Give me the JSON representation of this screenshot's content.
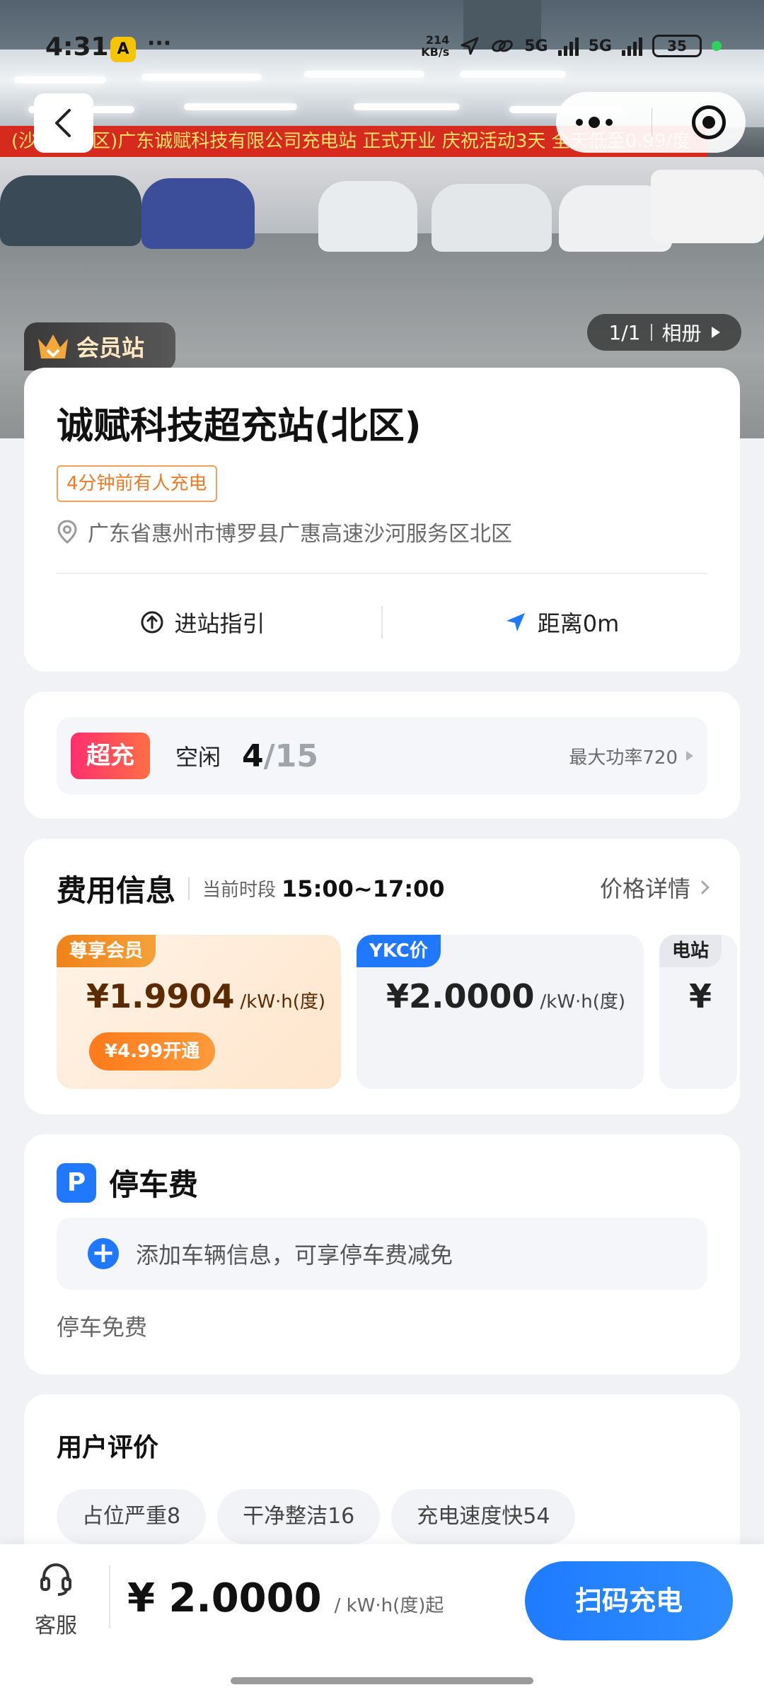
{
  "status_bar": {
    "time": "4:31",
    "more": "···",
    "speed": "214\nKB/s",
    "signal_1": "5G",
    "signal_2": "5G",
    "battery": "35"
  },
  "hero": {
    "banner_text": "(沙河服务区)广东诚赋科技有限公司充电站 正式开业 庆祝活动3天 全天低至0.99/度",
    "member_tag": "会员站",
    "album_index": "1/1",
    "album_label": "相册"
  },
  "station": {
    "name": "诚赋科技超充站(北区)",
    "recent": "4分钟前有人充电",
    "address": "广东省惠州市博罗县广惠高速沙河服务区北区",
    "guide_label": "进站指引",
    "distance_label": "距离0m"
  },
  "availability": {
    "badge": "超充",
    "idle_label": "空闲",
    "idle_count": "4",
    "total": "/15",
    "max_power": "最大功率720"
  },
  "fees": {
    "title": "费用信息",
    "period_label": "当前时段",
    "period": "15:00~17:00",
    "detail_link": "价格详情",
    "cards": [
      {
        "tag": "尊享会员",
        "price": "¥1.9904",
        "unit": "/kW·h(度)",
        "action": "¥4.99开通"
      },
      {
        "tag": "YKC价",
        "price": "¥2.0000",
        "unit": "/kW·h(度)"
      },
      {
        "tag": "电站",
        "price": "¥"
      }
    ]
  },
  "parking": {
    "icon_letter": "P",
    "title": "停车费",
    "add_vehicle": "添加车辆信息，可享停车费减免",
    "free_note": "停车免费"
  },
  "reviews": {
    "title": "用户评价",
    "tags": [
      "占位严重8",
      "干净整洁16",
      "充电速度快54"
    ]
  },
  "bottom": {
    "service_label": "客服",
    "price": "¥ 2.0000",
    "unit": "/ kW·h(度)起",
    "scan_button": "扫码充电"
  },
  "colors": {
    "accent_blue": "#1f78ff",
    "member_orange": "#f08218",
    "super_pink": "#ff2f6d"
  }
}
